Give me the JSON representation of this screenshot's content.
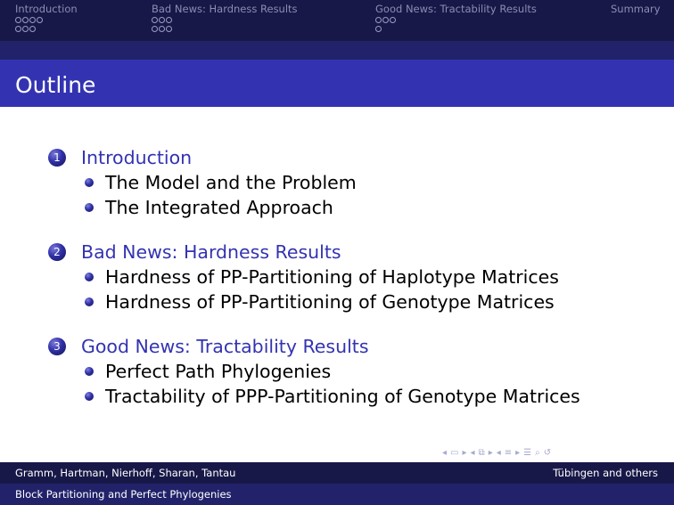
{
  "header": {
    "sections": [
      {
        "label": "Introduction",
        "rows": [
          4,
          3
        ]
      },
      {
        "label": "Bad News: Hardness Results",
        "rows": [
          3,
          3
        ]
      },
      {
        "label": "Good News: Tractability Results",
        "rows": [
          3,
          1
        ]
      },
      {
        "label": "Summary",
        "rows": []
      }
    ]
  },
  "frame": {
    "title": "Outline"
  },
  "outline": [
    {
      "number": "1",
      "title": "Introduction",
      "items": [
        "The Model and the Problem",
        "The Integrated Approach"
      ]
    },
    {
      "number": "2",
      "title": "Bad News: Hardness Results",
      "items": [
        "Hardness of PP-Partitioning of Haplotype Matrices",
        "Hardness of PP-Partitioning of Genotype Matrices"
      ]
    },
    {
      "number": "3",
      "title": "Good News: Tractability Results",
      "items": [
        "Perfect Path Phylogenies",
        "Tractability of PPP-Partitioning of Genotype Matrices"
      ]
    }
  ],
  "navigation_icons": [
    "prev-frame-icon",
    "frame-icon",
    "next-frame-icon",
    "prev-subsection-icon",
    "subsection-icon",
    "next-subsection-icon",
    "prev-section-icon",
    "section-icon",
    "next-section-icon",
    "align-icon",
    "search-icon",
    "back-icon"
  ],
  "footer": {
    "authors": "Gramm, Hartman, Nierhoff, Sharan, Tantau",
    "institute": "Tübingen and others",
    "title": "Block Partitioning and Perfect Phylogenies"
  },
  "colors": {
    "header_bg": "#181848",
    "title_bar": "#3333b2",
    "section_title": "#3333b2",
    "footer_bg": "#181848"
  }
}
